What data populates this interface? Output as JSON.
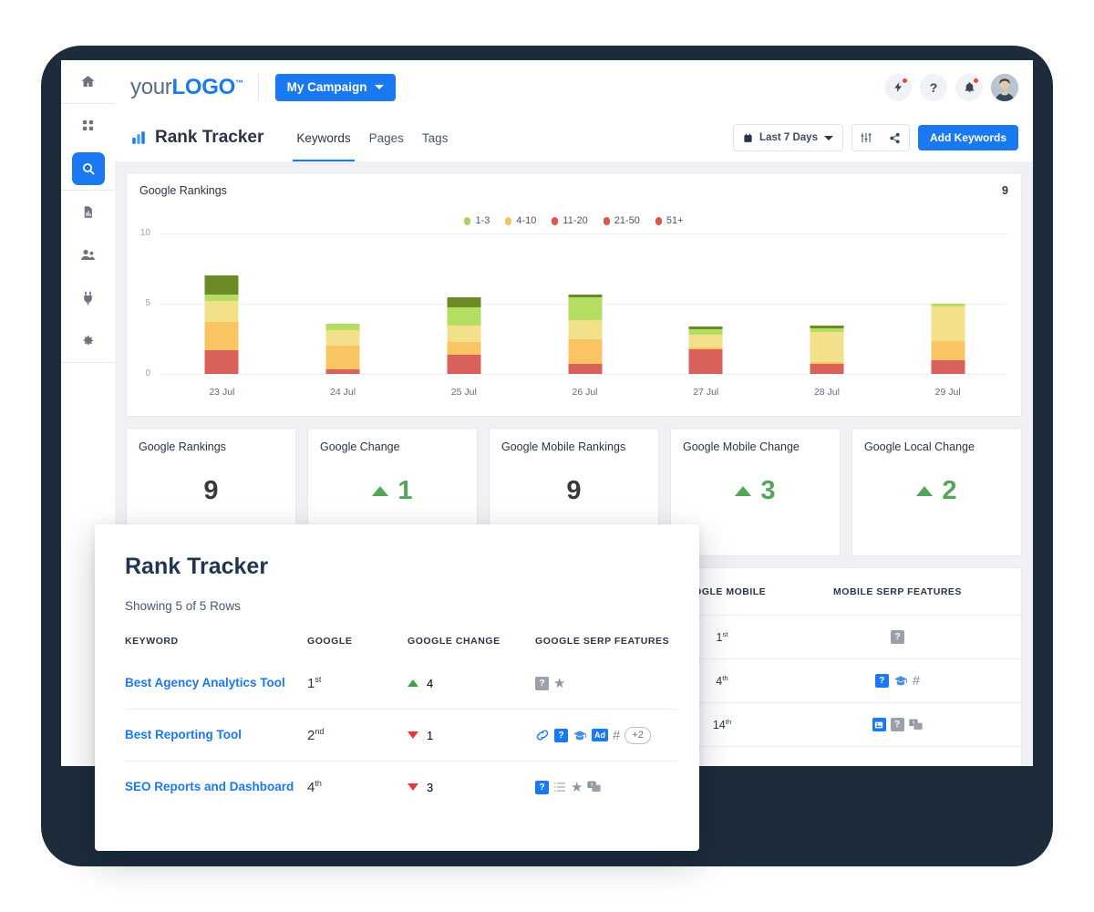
{
  "sidebar": {
    "items": [
      {
        "id": "home",
        "icon": "home-icon",
        "active": false
      },
      {
        "id": "dashboard",
        "icon": "grid-icon",
        "active": false
      },
      {
        "id": "search",
        "icon": "search-icon",
        "active": true
      },
      {
        "id": "reports",
        "icon": "report-document-icon",
        "active": false
      },
      {
        "id": "clients",
        "icon": "users-icon",
        "active": false
      },
      {
        "id": "integrations",
        "icon": "plug-icon",
        "active": false
      },
      {
        "id": "settings",
        "icon": "gear-icon",
        "active": false
      }
    ]
  },
  "topbar": {
    "logo_pre": "your",
    "logo_bold": "LOGO",
    "logo_tm": "™",
    "campaign_label": "My Campaign",
    "actions": [
      {
        "name": "upgrade-bolt-icon",
        "glyph": "bolt",
        "badge": true
      },
      {
        "name": "help-icon",
        "glyph": "?",
        "badge": false
      },
      {
        "name": "notifications-bell-icon",
        "glyph": "bell",
        "badge": true
      }
    ],
    "avatar_name": "user-avatar"
  },
  "pagehead": {
    "title": "Rank Tracker",
    "title_icon": "bar-chart-icon",
    "tabs": [
      {
        "label": "Keywords",
        "active": true
      },
      {
        "label": "Pages",
        "active": false
      },
      {
        "label": "Tags",
        "active": false
      }
    ],
    "date_range": "Last 7 Days",
    "filter_icon": "filter-sliders-icon",
    "share_icon": "share-icon",
    "add_button": "Add Keywords"
  },
  "chart_data": {
    "type": "bar",
    "stacked": true,
    "title": "Google Rankings",
    "total_label": "9",
    "xlabel": "",
    "ylabel": "",
    "ylim": [
      0,
      10
    ],
    "yticks": [
      0,
      5,
      10
    ],
    "grid": true,
    "legend_position": "top-center",
    "categories": [
      "23 Jul",
      "24 Jul",
      "25 Jul",
      "26 Jul",
      "27 Jul",
      "28 Jul",
      "29 Jul"
    ],
    "series": [
      {
        "name": "1-3",
        "color": "#b5dd62",
        "values": [
          0.45,
          0.5,
          1.3,
          1.6,
          0.4,
          0.25,
          0.2
        ]
      },
      {
        "name": "4-10",
        "color": "#f2e08a",
        "values": [
          1.5,
          1.1,
          1.2,
          1.4,
          0.9,
          2.15,
          2.45
        ]
      },
      {
        "name": "11-20",
        "color": "#f9c462",
        "values": [
          2.0,
          1.7,
          0.9,
          1.75,
          0.15,
          0.15,
          1.35
        ]
      },
      {
        "name": "21-50",
        "color": "#d8615c",
        "values": [
          1.7,
          0.3,
          1.35,
          0.7,
          1.75,
          0.7,
          1.0
        ]
      },
      {
        "name": "51+",
        "color": "#6a8b26",
        "values": [
          1.35,
          0.0,
          0.7,
          0.2,
          0.15,
          0.2,
          0.0
        ]
      }
    ],
    "stack_order": [
      "21-50",
      "11-20",
      "4-10",
      "1-3",
      "51+"
    ],
    "legend": [
      {
        "label": "1-3",
        "color": "#a8d45a"
      },
      {
        "label": "4-10",
        "color": "#f6c65c"
      },
      {
        "label": "11-20",
        "color": "#e4574f"
      },
      {
        "label": "21-50",
        "color": "#e0544c"
      },
      {
        "label": "51+",
        "color": "#e0544c"
      }
    ]
  },
  "metrics": [
    {
      "title": "Google Rankings",
      "value": "9",
      "direction": "none"
    },
    {
      "title": "Google Change",
      "value": "1",
      "direction": "up"
    },
    {
      "title": "Google Mobile Rankings",
      "value": "9",
      "direction": "none"
    },
    {
      "title": "Google Mobile Change",
      "value": "3",
      "direction": "up"
    },
    {
      "title": "Google Local Change",
      "value": "2",
      "direction": "up"
    }
  ],
  "background_table": {
    "headers": [
      "GOOGLE MOBILE",
      "MOBILE SERP FEATURES"
    ],
    "rows": [
      {
        "mobile_rank": "1",
        "mobile_suffix": "st",
        "features": [
          {
            "type": "chip-gray",
            "text": "?"
          }
        ]
      },
      {
        "mobile_rank": "4",
        "mobile_suffix": "th",
        "features": [
          {
            "type": "chip-blue",
            "text": "?"
          },
          {
            "type": "cap-blue",
            "text": ""
          },
          {
            "type": "hash",
            "text": "#"
          }
        ]
      },
      {
        "mobile_rank": "14",
        "mobile_suffix": "th",
        "features": [
          {
            "type": "image-blue",
            "text": ""
          },
          {
            "type": "chip-gray",
            "text": "?"
          },
          {
            "type": "chat-gray",
            "text": ""
          }
        ]
      }
    ]
  },
  "overlay": {
    "title": "Rank Tracker",
    "subtitle": "Showing 5 of 5 Rows",
    "headers": {
      "keyword": "KEYWORD",
      "google": "GOOGLE",
      "google_change": "GOOGLE CHANGE",
      "google_serp_features": "GOOGLE SERP FEATURES"
    },
    "rows": [
      {
        "keyword": "Best Agency Analytics Tool",
        "rank": "1",
        "rank_suffix": "st",
        "change": "4",
        "change_dir": "up",
        "features": [
          {
            "type": "chip-gray",
            "text": "?"
          },
          {
            "type": "star-gray",
            "text": "★"
          }
        ]
      },
      {
        "keyword": "Best Reporting Tool",
        "rank": "2",
        "rank_suffix": "nd",
        "change": "1",
        "change_dir": "down",
        "features": [
          {
            "type": "link-blue",
            "text": ""
          },
          {
            "type": "chip-blue",
            "text": "?"
          },
          {
            "type": "cap-blue",
            "text": ""
          },
          {
            "type": "ad-blue",
            "text": "Ad"
          },
          {
            "type": "hash",
            "text": "#"
          },
          {
            "type": "plus",
            "text": "+2"
          }
        ]
      },
      {
        "keyword": "SEO Reports and Dashboard",
        "rank": "4",
        "rank_suffix": "th",
        "change": "3",
        "change_dir": "down",
        "features": [
          {
            "type": "chip-blue",
            "text": "?"
          },
          {
            "type": "list-gray",
            "text": ""
          },
          {
            "type": "star-gray",
            "text": "★"
          },
          {
            "type": "chat-gray",
            "text": ""
          }
        ]
      }
    ]
  },
  "colors": {
    "accent": "#1a79f0",
    "bezel": "#1d2c3a",
    "up": "#53a55a",
    "down": "#e53935",
    "page_bg": "#eff1f4"
  }
}
